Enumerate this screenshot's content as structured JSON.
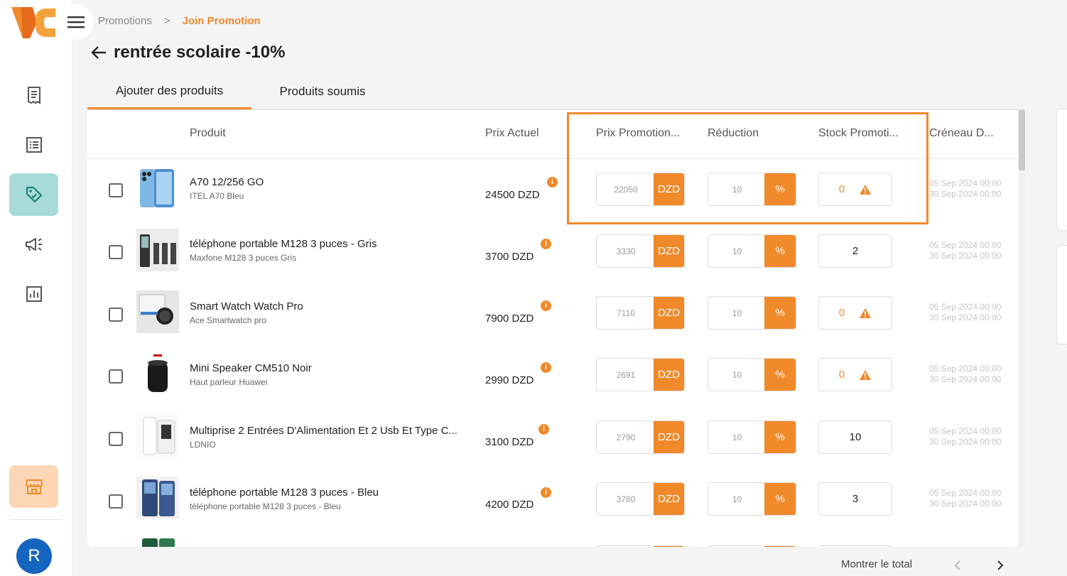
{
  "breadcrumb": {
    "parent": "Promotions",
    "separator": ">",
    "current": "Join Promotion"
  },
  "page": {
    "title": "rentrée scolaire -10%"
  },
  "tabs": [
    {
      "label": "Ajouter des produits",
      "active": true
    },
    {
      "label": "Produits soumis",
      "active": false
    }
  ],
  "columns": {
    "product": "Produit",
    "current_price": "Prix Actuel",
    "promo_price": "Prix Promotion...",
    "reduction": "Réduction",
    "promo_stock": "Stock Promoti...",
    "slot": "Créneau D..."
  },
  "rows": [
    {
      "name": "A70 12/256 GO",
      "sub": "ITEL A70 Bleu",
      "price": "24500 DZD",
      "promo_price": "22050",
      "currency": "DZD",
      "reduction": "10",
      "percent": "%",
      "stock": "0",
      "slot_start": "05 Sep 2024 00:00",
      "slot_end": "30 Sep 2024 00:00"
    },
    {
      "name": "téléphone portable M128 3 puces - Gris",
      "sub": "Maxfone M128 3 puces Gris",
      "price": "3700 DZD",
      "promo_price": "3330",
      "currency": "DZD",
      "reduction": "10",
      "percent": "%",
      "stock": "2",
      "slot_start": "05 Sep 2024 00:00",
      "slot_end": "30 Sep 2024 00:00"
    },
    {
      "name": "Smart Watch Watch Pro",
      "sub": "Ace Smartwatch pro",
      "price": "7900 DZD",
      "promo_price": "7110",
      "currency": "DZD",
      "reduction": "10",
      "percent": "%",
      "stock": "0",
      "slot_start": "05 Sep 2024 00:00",
      "slot_end": "30 Sep 2024 00:00"
    },
    {
      "name": "Mini Speaker CM510 Noir",
      "sub": "Haut parleur Huawei",
      "price": "2990 DZD",
      "promo_price": "2691",
      "currency": "DZD",
      "reduction": "10",
      "percent": "%",
      "stock": "0",
      "slot_start": "05 Sep 2024 00:00",
      "slot_end": "30 Sep 2024 00:00"
    },
    {
      "name": "Multiprise 2 Entrées D'Alimentation Et 2 Usb Et Type C...",
      "sub": "LDNIO",
      "price": "3100 DZD",
      "promo_price": "2790",
      "currency": "DZD",
      "reduction": "10",
      "percent": "%",
      "stock": "10",
      "slot_start": "05 Sep 2024 00:00",
      "slot_end": "30 Sep 2024 00:00"
    },
    {
      "name": "téléphone portable M128 3 puces - Bleu",
      "sub": "téléphone portable M128 3 puces - Bleu",
      "price": "4200 DZD",
      "promo_price": "3780",
      "currency": "DZD",
      "reduction": "10",
      "percent": "%",
      "stock": "3",
      "slot_start": "05 Sep 2024 00:00",
      "slot_end": "30 Sep 2024 00:00"
    }
  ],
  "footer": {
    "show_total": "Montrer le total"
  },
  "user": {
    "initial": "R"
  },
  "colors": {
    "accent": "#f0892a",
    "active_nav": "#a8dbd7",
    "store_nav": "#fdd6b6",
    "avatar": "#1565c0"
  }
}
